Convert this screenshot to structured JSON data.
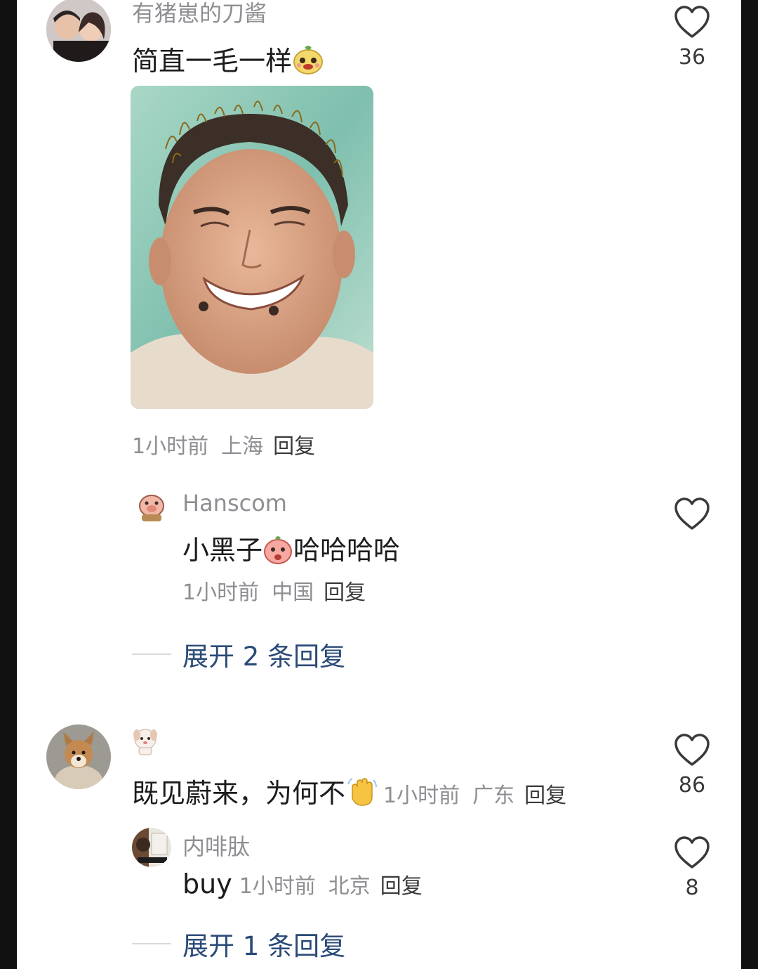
{
  "comments": [
    {
      "username": "有猪崽的刀酱",
      "text": "简直一毛一样",
      "emoji_icon": "grinning-face-sticker-icon",
      "image_desc_icon": "photo-man-smiling",
      "time": "1小时前",
      "location": "上海",
      "reply_label": "回复",
      "likes": "36",
      "replies": [
        {
          "username": "Hanscom",
          "text_before": "小黑子",
          "emoji_icon": "peach-cheeky-sticker-icon",
          "text_after": "哈哈哈哈",
          "time": "1小时前",
          "location": "中国",
          "reply_label": "回复"
        }
      ],
      "expand_label": "展开 2 条回复"
    },
    {
      "username_icon": "puppy-sticker-icon",
      "text": "既见蔚来，为何不",
      "emoji_icon": "waving-hand-icon",
      "time": "1小时前",
      "location": "广东",
      "reply_label": "回复",
      "likes": "86",
      "replies": [
        {
          "username": "内啡肽",
          "text": "buy",
          "time": "1小时前",
          "location": "北京",
          "reply_label": "回复",
          "likes": "8"
        }
      ],
      "expand_label": "展开 1 条回复"
    }
  ],
  "colors": {
    "link_blue": "#2a4a77",
    "meta_gray": "#8e8e93",
    "text_dark": "#1c1c1e"
  }
}
